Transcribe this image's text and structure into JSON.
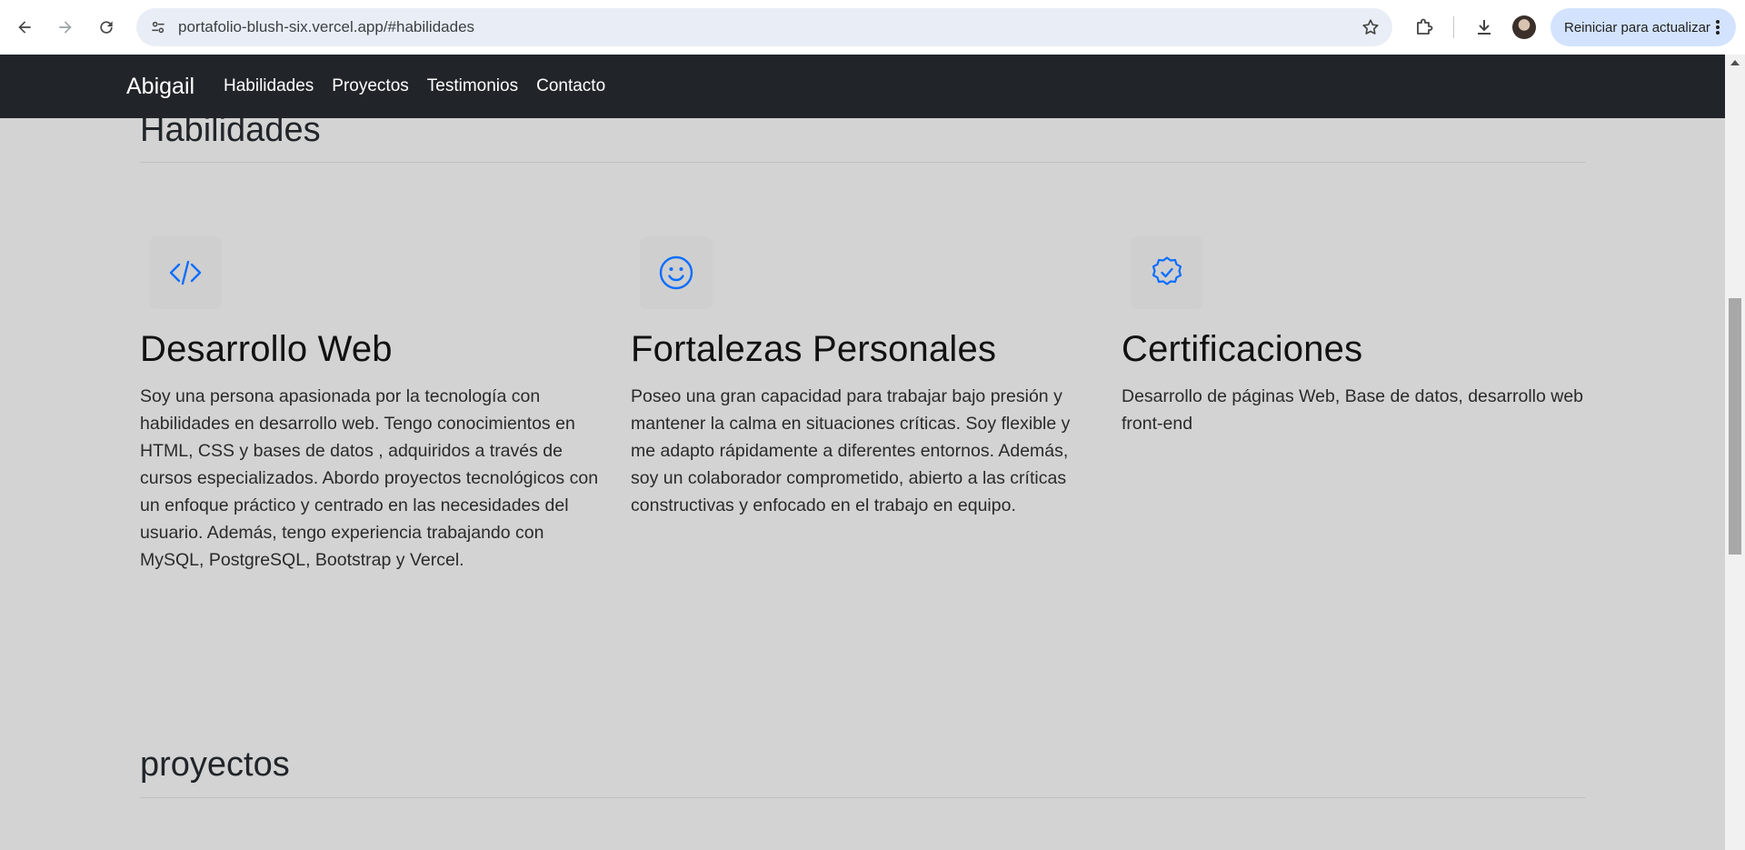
{
  "browser": {
    "url": "portafolio-blush-six.vercel.app/#habilidades",
    "update_button": "Reiniciar para actualizar"
  },
  "navbar": {
    "brand": "Abigail",
    "links": [
      "Habilidades",
      "Proyectos",
      "Testimonios",
      "Contacto"
    ]
  },
  "skills": {
    "title": "Habilidades",
    "features": [
      {
        "icon": "code-icon",
        "title": "Desarrollo Web",
        "text": "Soy una persona apasionada por la tecnología con habilidades en desarrollo web. Tengo conocimientos en HTML, CSS y bases de datos , adquiridos a través de cursos especializados. Abordo proyectos tecnológicos con un enfoque práctico y centrado en las necesidades del usuario. Además, tengo experiencia trabajando con MySQL, PostgreSQL, Bootstrap y Vercel."
      },
      {
        "icon": "smiley-icon",
        "title": "Fortalezas Personales",
        "text": "Poseo una gran capacidad para trabajar bajo presión y mantener la calma en situaciones críticas. Soy flexible y me adapto rápidamente a diferentes entornos. Además, soy un colaborador comprometido, abierto a las críticas constructivas y enfocado en el trabajo en equipo."
      },
      {
        "icon": "patch-check-icon",
        "title": "Certificaciones",
        "text": "Desarrollo de páginas Web, Base de datos, desarrollo web front-end"
      }
    ]
  },
  "projects": {
    "title": "proyectos"
  },
  "colors": {
    "navbar_bg": "#212529",
    "page_bg": "#d3d3d3",
    "icon_accent": "#0d6efd",
    "update_button_bg": "#d3e3fd"
  }
}
